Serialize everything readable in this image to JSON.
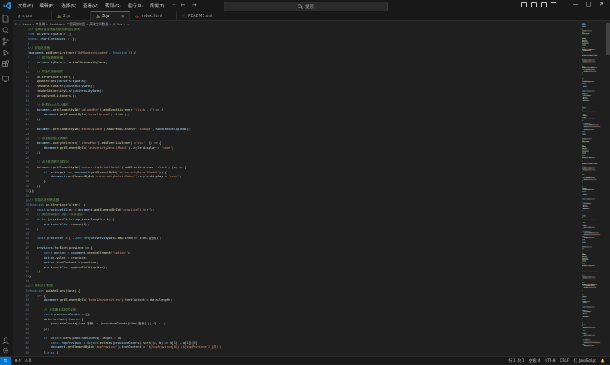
{
  "menu": [
    "文件(F)",
    "编辑(E)",
    "选择(S)",
    "查看(V)",
    "转到(G)",
    "运行(R)",
    "终端(T)"
  ],
  "search": {
    "placeholder": "搜索"
  },
  "tabs": [
    {
      "label": "s.css",
      "kind": "css"
    },
    {
      "label": "2.js",
      "kind": "js"
    },
    {
      "label": "3.js",
      "kind": "js",
      "active": true
    },
    {
      "label": "index.html",
      "kind": "html"
    },
    {
      "label": "README.md",
      "kind": "md"
    }
  ],
  "breadcrumb": "C: > Users > 李佳琪 > Desktop > 中国高校地图 > 高校空间数据 > JS 3.js > ...",
  "code_lines": [
    [
      [
        "c",
        "// 全局变量存储高校数据和图表实例"
      ]
    ],
    [
      [
        "k",
        "let "
      ],
      [
        "v",
        "universityData"
      ],
      [
        "p",
        " = [];"
      ]
    ],
    [
      [
        "k",
        "const "
      ],
      [
        "v",
        "chartInstances"
      ],
      [
        "p",
        " = {};"
      ]
    ],
    [],
    [
      [
        "c",
        "// 初始化页面"
      ]
    ],
    [
      [
        "v",
        "document"
      ],
      [
        "p",
        "."
      ],
      [
        "f",
        "addEventListener"
      ],
      [
        "p",
        "("
      ],
      [
        "s",
        "'DOMContentLoaded'"
      ],
      [
        "p",
        ", "
      ],
      [
        "k",
        "function"
      ],
      [
        "p",
        " () {"
      ]
    ],
    [
      [
        "p",
        "    "
      ],
      [
        "c",
        "// 将初始数据赋值"
      ]
    ],
    [
      [
        "p",
        "    "
      ],
      [
        "v",
        "universityData"
      ],
      [
        "p",
        " = "
      ],
      [
        "f",
        "initialUniversityData"
      ],
      [
        "p",
        ";"
      ]
    ],
    [],
    [
      [
        "p",
        "    "
      ],
      [
        "c",
        "// 初始化页面组件"
      ]
    ],
    [
      [
        "p",
        "    "
      ],
      [
        "f",
        "initProvinceFilter"
      ],
      [
        "p",
        "();"
      ]
    ],
    [
      [
        "p",
        "    "
      ],
      [
        "f",
        "updateStats"
      ],
      [
        "p",
        "("
      ],
      [
        "v",
        "universityData"
      ],
      [
        "p",
        ");"
      ]
    ],
    [
      [
        "p",
        "    "
      ],
      [
        "f",
        "renderAllCharts"
      ],
      [
        "p",
        "("
      ],
      [
        "v",
        "universityData"
      ],
      [
        "p",
        ");"
      ]
    ],
    [
      [
        "p",
        "    "
      ],
      [
        "f",
        "renderUniversityList"
      ],
      [
        "p",
        "("
      ],
      [
        "v",
        "universityData"
      ],
      [
        "p",
        ");"
      ]
    ],
    [
      [
        "p",
        "    "
      ],
      [
        "f",
        "setupEventListeners"
      ],
      [
        "p",
        "();"
      ]
    ],
    [],
    [
      [
        "p",
        "    "
      ],
      [
        "c",
        "// 处理Excel导入事件"
      ]
    ],
    [
      [
        "p",
        "    "
      ],
      [
        "v",
        "document"
      ],
      [
        "p",
        "."
      ],
      [
        "f",
        "getElementById"
      ],
      [
        "p",
        "("
      ],
      [
        "s",
        "'uploadBtn'"
      ],
      [
        "p",
        ")."
      ],
      [
        "f",
        "addEventListener"
      ],
      [
        "p",
        "("
      ],
      [
        "s",
        "'click'"
      ],
      [
        "p",
        ", () => {"
      ]
    ],
    [
      [
        "p",
        "        "
      ],
      [
        "v",
        "document"
      ],
      [
        "p",
        "."
      ],
      [
        "f",
        "getElementById"
      ],
      [
        "p",
        "("
      ],
      [
        "s",
        "'excelUpload'"
      ],
      [
        "p",
        ")."
      ],
      [
        "f",
        "click"
      ],
      [
        "p",
        "();"
      ]
    ],
    [
      [
        "p",
        "    });"
      ]
    ],
    [],
    [
      [
        "p",
        "    "
      ],
      [
        "v",
        "document"
      ],
      [
        "p",
        "."
      ],
      [
        "f",
        "getElementById"
      ],
      [
        "p",
        "("
      ],
      [
        "s",
        "'excelUpload'"
      ],
      [
        "p",
        ")."
      ],
      [
        "f",
        "addEventListener"
      ],
      [
        "p",
        "("
      ],
      [
        "s",
        "'change'"
      ],
      [
        "p",
        ", "
      ],
      [
        "v",
        "handleExcelUpload"
      ],
      [
        "p",
        ");"
      ]
    ],
    [],
    [
      [
        "p",
        "    "
      ],
      [
        "c",
        "// 设置模态框关闭事件"
      ]
    ],
    [
      [
        "p",
        "    "
      ],
      [
        "v",
        "document"
      ],
      [
        "p",
        "."
      ],
      [
        "f",
        "querySelector"
      ],
      [
        "p",
        "("
      ],
      [
        "s",
        "'.closeMon'"
      ],
      [
        "p",
        ")."
      ],
      [
        "f",
        "addEventListener"
      ],
      [
        "p",
        "("
      ],
      [
        "s",
        "'click'"
      ],
      [
        "p",
        ", () => {"
      ]
    ],
    [
      [
        "p",
        "        "
      ],
      [
        "v",
        "document"
      ],
      [
        "p",
        "."
      ],
      [
        "f",
        "getElementById"
      ],
      [
        "p",
        "("
      ],
      [
        "s",
        "'universityDetailModal'"
      ],
      [
        "p",
        ").style.display = "
      ],
      [
        "s",
        "'none'"
      ],
      [
        "p",
        ";"
      ]
    ],
    [
      [
        "p",
        "    });"
      ]
    ],
    [],
    [
      [
        "p",
        "    "
      ],
      [
        "c",
        "// 点击模态框外部关闭"
      ]
    ],
    [
      [
        "p",
        "    "
      ],
      [
        "v",
        "document"
      ],
      [
        "p",
        "."
      ],
      [
        "f",
        "getElementById"
      ],
      [
        "p",
        "("
      ],
      [
        "s",
        "'universityDetailModal'"
      ],
      [
        "p",
        ")."
      ],
      [
        "f",
        "addEventListener"
      ],
      [
        "p",
        "("
      ],
      [
        "s",
        "'click'"
      ],
      [
        "p",
        ", (e) => {"
      ]
    ],
    [
      [
        "p",
        "        "
      ],
      [
        "k",
        "if"
      ],
      [
        "p",
        " (e.target === "
      ],
      [
        "v",
        "document"
      ],
      [
        "p",
        "."
      ],
      [
        "f",
        "getElementById"
      ],
      [
        "p",
        "("
      ],
      [
        "s",
        "'universityDetailModal'"
      ],
      [
        "p",
        ")) {"
      ]
    ],
    [
      [
        "p",
        "            "
      ],
      [
        "v",
        "document"
      ],
      [
        "p",
        "."
      ],
      [
        "f",
        "getElementById"
      ],
      [
        "p",
        "("
      ],
      [
        "s",
        "'universityDetailModal'"
      ],
      [
        "p",
        ").style.display = "
      ],
      [
        "s",
        "'none'"
      ],
      [
        "p",
        ";"
      ]
    ],
    [
      [
        "p",
        "        }"
      ]
    ],
    [
      [
        "p",
        "    });"
      ]
    ],
    [
      [
        "p",
        "});"
      ]
    ],
    [],
    [
      [
        "c",
        "// 初始化省份筛选器"
      ]
    ],
    [
      [
        "k",
        "function "
      ],
      [
        "f",
        "initProvinceFilter"
      ],
      [
        "p",
        "() {"
      ]
    ],
    [
      [
        "p",
        "    "
      ],
      [
        "k",
        "const "
      ],
      [
        "v",
        "provinceFilter"
      ],
      [
        "p",
        " = "
      ],
      [
        "v",
        "document"
      ],
      [
        "p",
        "."
      ],
      [
        "f",
        "getElementById"
      ],
      [
        "p",
        "("
      ],
      [
        "s",
        "'provinceFilter'"
      ],
      [
        "p",
        ");"
      ]
    ],
    [
      [
        "p",
        "    "
      ],
      [
        "c",
        "// 清空现有选项（除了\"所有省份\"）"
      ]
    ],
    [
      [
        "p",
        "    "
      ],
      [
        "k",
        "while"
      ],
      [
        "p",
        " ("
      ],
      [
        "v",
        "provinceFilter"
      ],
      [
        "p",
        ".options.length > "
      ],
      [
        "n",
        "1"
      ],
      [
        "p",
        ") {"
      ]
    ],
    [
      [
        "p",
        "        "
      ],
      [
        "v",
        "provinceFilter"
      ],
      [
        "p",
        "."
      ],
      [
        "f",
        "remove"
      ],
      [
        "p",
        "("
      ],
      [
        "n",
        "1"
      ],
      [
        "p",
        ");"
      ]
    ],
    [
      [
        "p",
        "    }"
      ]
    ],
    [],
    [
      [
        "p",
        "    "
      ],
      [
        "k",
        "const "
      ],
      [
        "v",
        "provinces"
      ],
      [
        "p",
        " = [..."
      ],
      [
        "k",
        "new "
      ],
      [
        "cl",
        "Set"
      ],
      [
        "p",
        "("
      ],
      [
        "v",
        "universityData"
      ],
      [
        "p",
        "."
      ],
      [
        "f",
        "map"
      ],
      [
        "p",
        "(item => item.省份))];"
      ]
    ],
    [],
    [
      [
        "p",
        "    "
      ],
      [
        "v",
        "provinces"
      ],
      [
        "p",
        "."
      ],
      [
        "f",
        "forEach"
      ],
      [
        "p",
        "(province => {"
      ]
    ],
    [
      [
        "p",
        "        "
      ],
      [
        "k",
        "const "
      ],
      [
        "v",
        "option"
      ],
      [
        "p",
        " = "
      ],
      [
        "v",
        "document"
      ],
      [
        "p",
        "."
      ],
      [
        "f",
        "createElement"
      ],
      [
        "p",
        "("
      ],
      [
        "s",
        "'option'"
      ],
      [
        "p",
        ");"
      ]
    ],
    [
      [
        "p",
        "        "
      ],
      [
        "v",
        "option"
      ],
      [
        "p",
        ".value = province;"
      ]
    ],
    [
      [
        "p",
        "        "
      ],
      [
        "v",
        "option"
      ],
      [
        "p",
        ".textContent = province;"
      ]
    ],
    [
      [
        "p",
        "        "
      ],
      [
        "v",
        "provinceFilter"
      ],
      [
        "p",
        "."
      ],
      [
        "f",
        "appendChild"
      ],
      [
        "p",
        "(option);"
      ]
    ],
    [
      [
        "p",
        "    });"
      ]
    ],
    [
      [
        "p",
        "}"
      ]
    ],
    [],
    [
      [
        "c",
        "// 更新统计数据"
      ]
    ],
    [
      [
        "k",
        "function "
      ],
      [
        "f",
        "updateStats"
      ],
      [
        "p",
        "(data) {"
      ]
    ],
    [
      [
        "p",
        "    "
      ],
      [
        "k",
        "try"
      ],
      [
        "p",
        " {"
      ]
    ],
    [
      [
        "p",
        "        "
      ],
      [
        "v",
        "document"
      ],
      [
        "p",
        "."
      ],
      [
        "f",
        "getElementById"
      ],
      [
        "p",
        "("
      ],
      [
        "s",
        "'totalUniversities'"
      ],
      [
        "p",
        ").textContent = data.length;"
      ]
    ],
    [],
    [
      [
        "p",
        "        "
      ],
      [
        "c",
        "// 计算最多高校的省份"
      ]
    ],
    [
      [
        "p",
        "        "
      ],
      [
        "k",
        "const "
      ],
      [
        "v",
        "provinceCounts"
      ],
      [
        "p",
        " = {};"
      ]
    ],
    [
      [
        "p",
        "        data."
      ],
      [
        "f",
        "forEach"
      ],
      [
        "p",
        "(item => {"
      ]
    ],
    [
      [
        "p",
        "            "
      ],
      [
        "v",
        "provinceCounts"
      ],
      [
        "p",
        "[item.省份] = ("
      ],
      [
        "v",
        "provinceCounts"
      ],
      [
        "p",
        "[item.省份] || "
      ],
      [
        "n",
        "0"
      ],
      [
        "p",
        ") + "
      ],
      [
        "n",
        "1"
      ],
      [
        "p",
        ";"
      ]
    ],
    [
      [
        "p",
        "        });"
      ]
    ],
    [],
    [
      [
        "p",
        "        "
      ],
      [
        "k",
        "if"
      ],
      [
        "p",
        " ("
      ],
      [
        "cl",
        "Object"
      ],
      [
        "p",
        "."
      ],
      [
        "f",
        "keys"
      ],
      [
        "p",
        "("
      ],
      [
        "v",
        "provinceCounts"
      ],
      [
        "p",
        ").length > "
      ],
      [
        "n",
        "0"
      ],
      [
        "p",
        ") {"
      ]
    ],
    [
      [
        "p",
        "            "
      ],
      [
        "k",
        "const "
      ],
      [
        "v",
        "topProvince"
      ],
      [
        "p",
        " = "
      ],
      [
        "cl",
        "Object"
      ],
      [
        "p",
        "."
      ],
      [
        "f",
        "entries"
      ],
      [
        "p",
        "("
      ],
      [
        "v",
        "provinceCounts"
      ],
      [
        "p",
        ")."
      ],
      [
        "f",
        "sort"
      ],
      [
        "p",
        "((a, b) => b["
      ],
      [
        "n",
        "1"
      ],
      [
        "p",
        "] - a["
      ],
      [
        "n",
        "1"
      ],
      [
        "p",
        "])["
      ],
      [
        "n",
        "0"
      ],
      [
        "p",
        "];"
      ]
    ],
    [
      [
        "p",
        "            "
      ],
      [
        "v",
        "document"
      ],
      [
        "p",
        "."
      ],
      [
        "f",
        "getElementById"
      ],
      [
        "p",
        "("
      ],
      [
        "s",
        "'topProvince'"
      ],
      [
        "p",
        ").textContent = "
      ],
      [
        "s",
        "`${topProvince[0]} (${topProvince[1]}所)`"
      ],
      [
        "p",
        ";"
      ]
    ],
    [
      [
        "p",
        "        } "
      ],
      [
        "k",
        "else"
      ],
      [
        "p",
        " {"
      ]
    ],
    [
      [
        "p",
        "            "
      ],
      [
        "v",
        "document"
      ],
      [
        "p",
        "."
      ],
      [
        "f",
        "getElementById"
      ],
      [
        "p",
        "("
      ],
      [
        "s",
        "'topProvince'"
      ],
      [
        "p",
        ").textContent = "
      ],
      [
        "s",
        "'--'"
      ],
      [
        "p",
        ";"
      ]
    ]
  ],
  "status": {
    "left": [
      "⊗ 0",
      "⚠ 0"
    ],
    "right": [
      "行 1, 列 1",
      "空格: 4",
      "UTF-8",
      "CRLF",
      "{} JavaScript",
      "🔔"
    ]
  },
  "colors": {
    "accent": "#0078d4",
    "background": "#1f1f1f",
    "chrome": "#181818"
  }
}
